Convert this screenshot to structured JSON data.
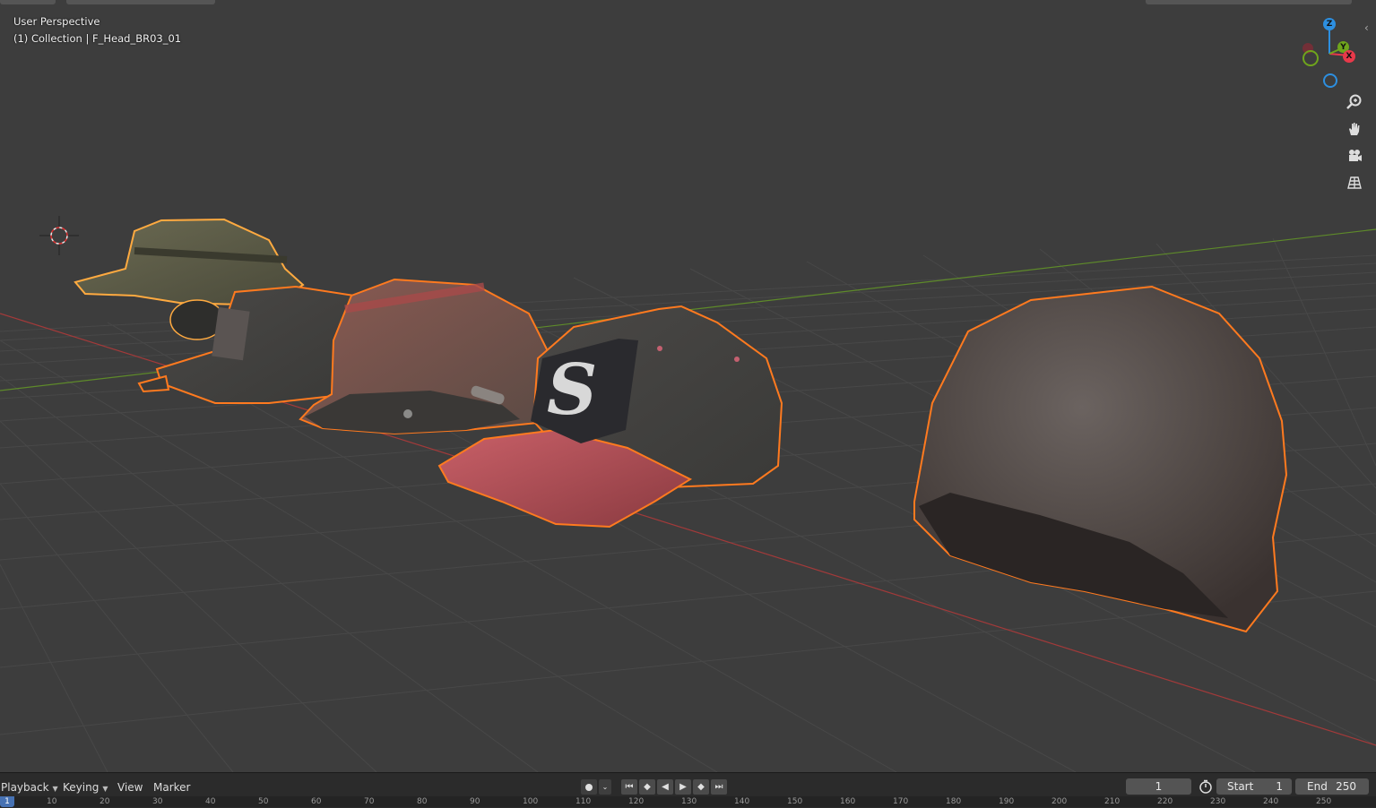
{
  "viewport": {
    "view_name": "User Perspective",
    "collection_info": "(1) Collection | F_Head_BR03_01"
  },
  "gizmo": {
    "z_label": "Z",
    "y_label": "Y",
    "x_label": "X",
    "colors": {
      "x": "#e8394a",
      "y": "#6fa51c",
      "z": "#2d8fe0"
    }
  },
  "nav_icons": [
    "zoom-icon",
    "hand-pan-icon",
    "camera-icon",
    "perspective-grid-icon"
  ],
  "timeline": {
    "menus": [
      {
        "label": "Playback",
        "dropdown": true
      },
      {
        "label": "Keying",
        "dropdown": true
      },
      {
        "label": "View",
        "dropdown": false
      },
      {
        "label": "Marker",
        "dropdown": false
      }
    ],
    "current_frame": "1",
    "start_label": "Start",
    "start_value": "1",
    "end_label": "End",
    "end_value": "250",
    "ruler_ticks": [
      "1",
      "10",
      "20",
      "30",
      "40",
      "50",
      "60",
      "70",
      "80",
      "90",
      "100",
      "110",
      "120",
      "130",
      "140",
      "150",
      "160",
      "170",
      "180",
      "190",
      "200",
      "210",
      "220",
      "230",
      "240",
      "250"
    ]
  },
  "colors": {
    "selection_outline": "#ff7a1f",
    "active_outline": "#ffaa40",
    "x_axis_line": "#a33a3a",
    "y_axis_line": "#5e8a2a",
    "accent": "#4772b3"
  }
}
